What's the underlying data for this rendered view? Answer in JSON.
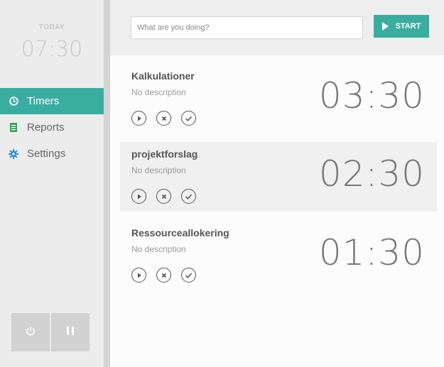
{
  "sidebar": {
    "today_label": "TODAY",
    "time": "07:30",
    "nav": [
      {
        "label": "Timers",
        "icon": "clock-icon",
        "active": true
      },
      {
        "label": "Reports",
        "icon": "report-icon",
        "active": false
      },
      {
        "label": "Settings",
        "icon": "gear-icon",
        "active": false
      }
    ]
  },
  "topbar": {
    "search_placeholder": "What are you doing?",
    "start_label": "START"
  },
  "timers": [
    {
      "name": "Kalkulationer",
      "description": "No description",
      "time": "03:30"
    },
    {
      "name": "projektforslag",
      "description": "No description",
      "time": "02:30"
    },
    {
      "name": "Ressourceallokering",
      "description": "No description",
      "time": "01:30"
    }
  ],
  "colors": {
    "accent": "#3aada1",
    "sidebar_bg": "#ececec",
    "highlight_row": "#f0f0f0"
  }
}
